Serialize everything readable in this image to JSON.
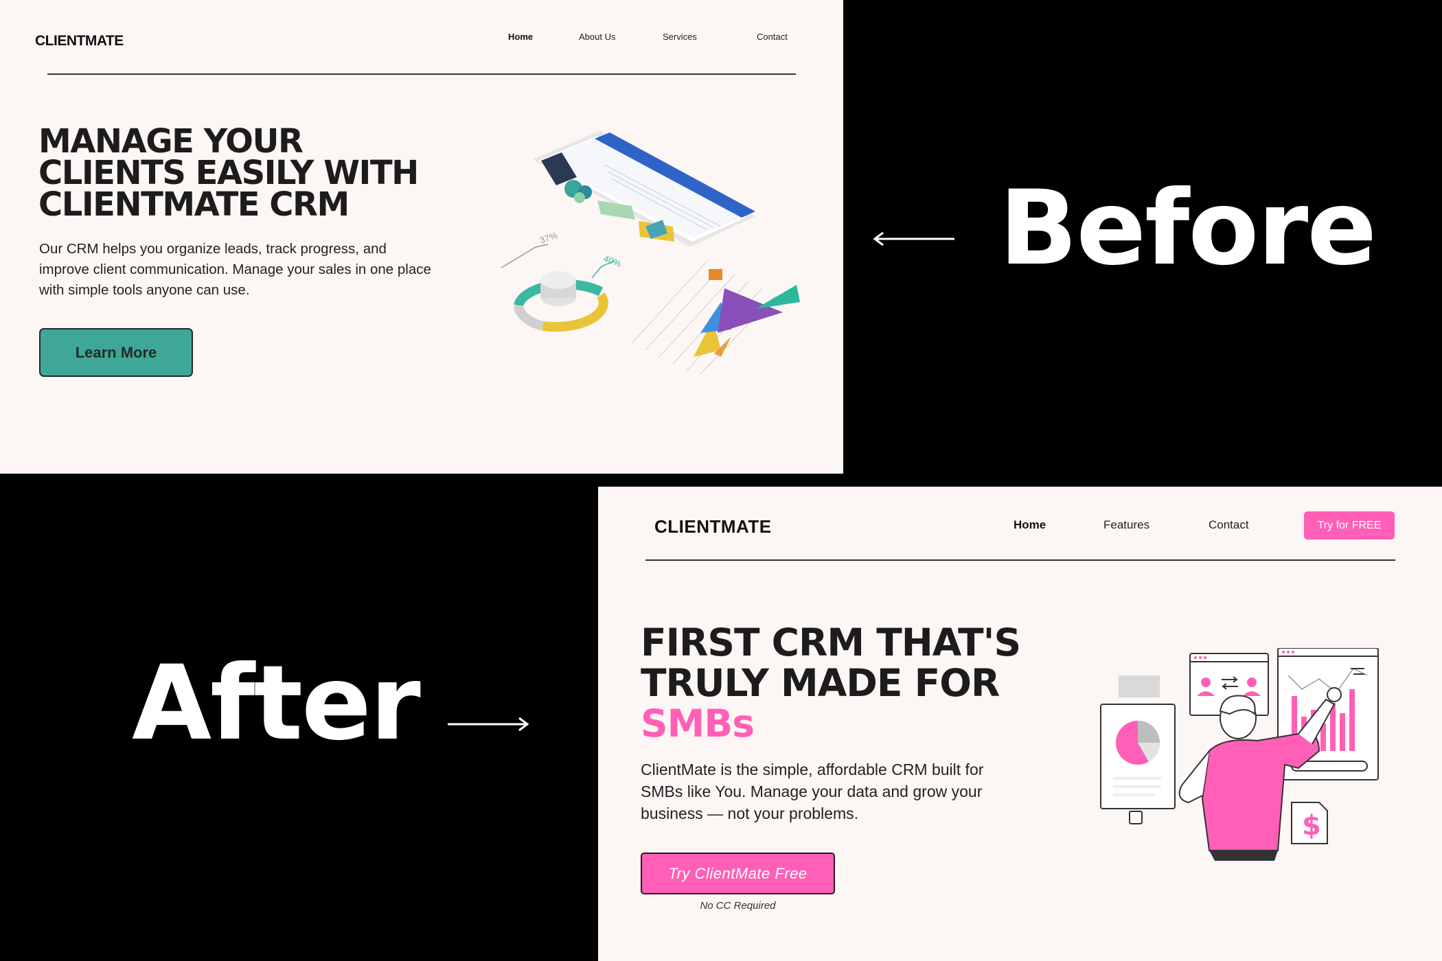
{
  "labels": {
    "before": "Before",
    "after": "After"
  },
  "before": {
    "logo": "CLIENTMATE",
    "nav": [
      "Home",
      "About Us",
      "Services",
      "Contact"
    ],
    "active_nav": "Home",
    "headline": "MANAGE YOUR CLIENTS EASILY WITH CLIENTMATE CRM",
    "body": "Our CRM helps you organize leads, track progress, and improve client communication. Manage your sales in one place with simple tools anyone can use.",
    "button": "Learn More",
    "illustration_labels": [
      "37%",
      "40%"
    ],
    "accent_color": "#3fa797"
  },
  "after": {
    "logo": "CLIENTMATE",
    "nav": [
      "Home",
      "Features",
      "Contact"
    ],
    "active_nav": "Home",
    "cta": "Try for FREE",
    "headline_line1": "FIRST CRM THAT'S",
    "headline_line2": "TRULY MADE FOR",
    "headline_accent": "SMBs",
    "body": "ClientMate is the simple, affordable CRM built for SMBs like You. Manage your data and grow your business — not your problems.",
    "button": "Try ClientMate Free",
    "note": "No CC Required",
    "accent_color": "#ff5fb6"
  }
}
